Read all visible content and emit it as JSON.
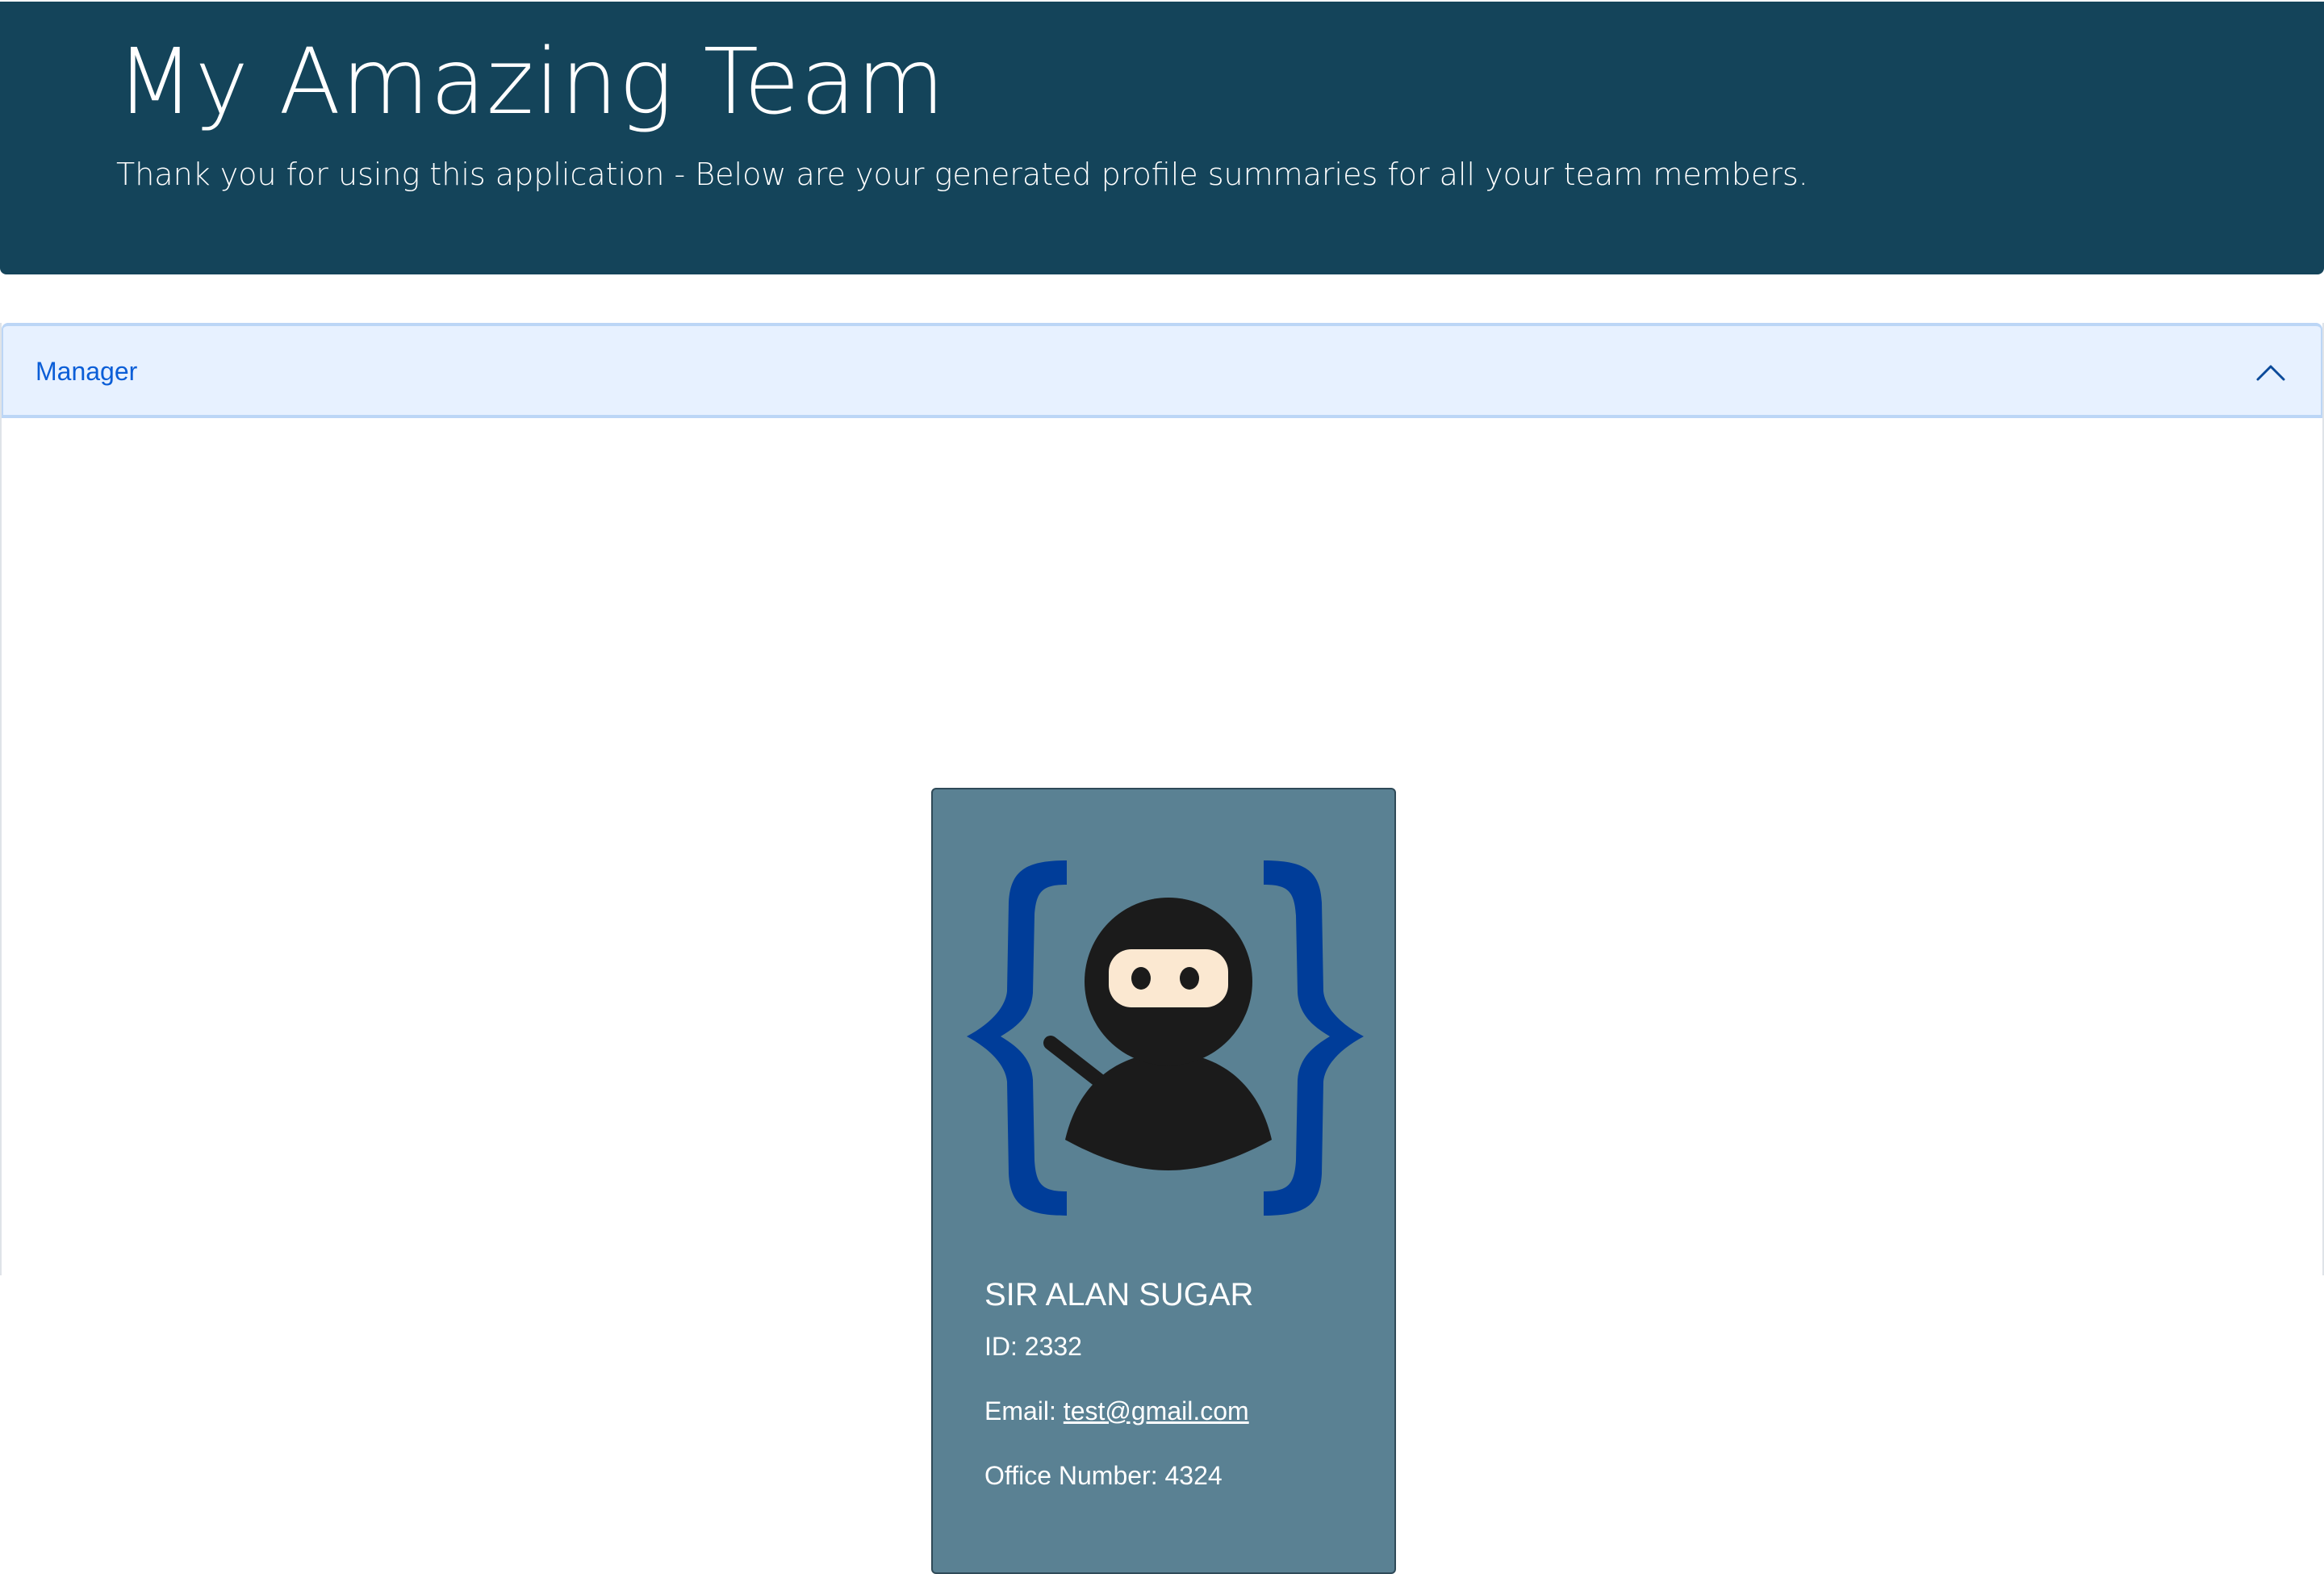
{
  "header": {
    "title": "My Amazing Team",
    "subtitle": "Thank you for using this application - Below are your generated profile summaries for all your team members."
  },
  "accordion": {
    "title": "Manager",
    "expanded": true
  },
  "card": {
    "avatar_icon": "ninja-braces-icon",
    "name": "SIR ALAN SUGAR",
    "id_label": "ID:",
    "id_value": "2332",
    "email_label": "Email:",
    "email_value": "test@gmail.com",
    "office_label": "Office Number:",
    "office_value": "4324"
  },
  "colors": {
    "header_bg": "#14445a",
    "accordion_bg": "#e7f1ff",
    "accordion_text": "#0b5ed7",
    "card_bg": "#5a8193",
    "brace_blue": "#003d99"
  }
}
